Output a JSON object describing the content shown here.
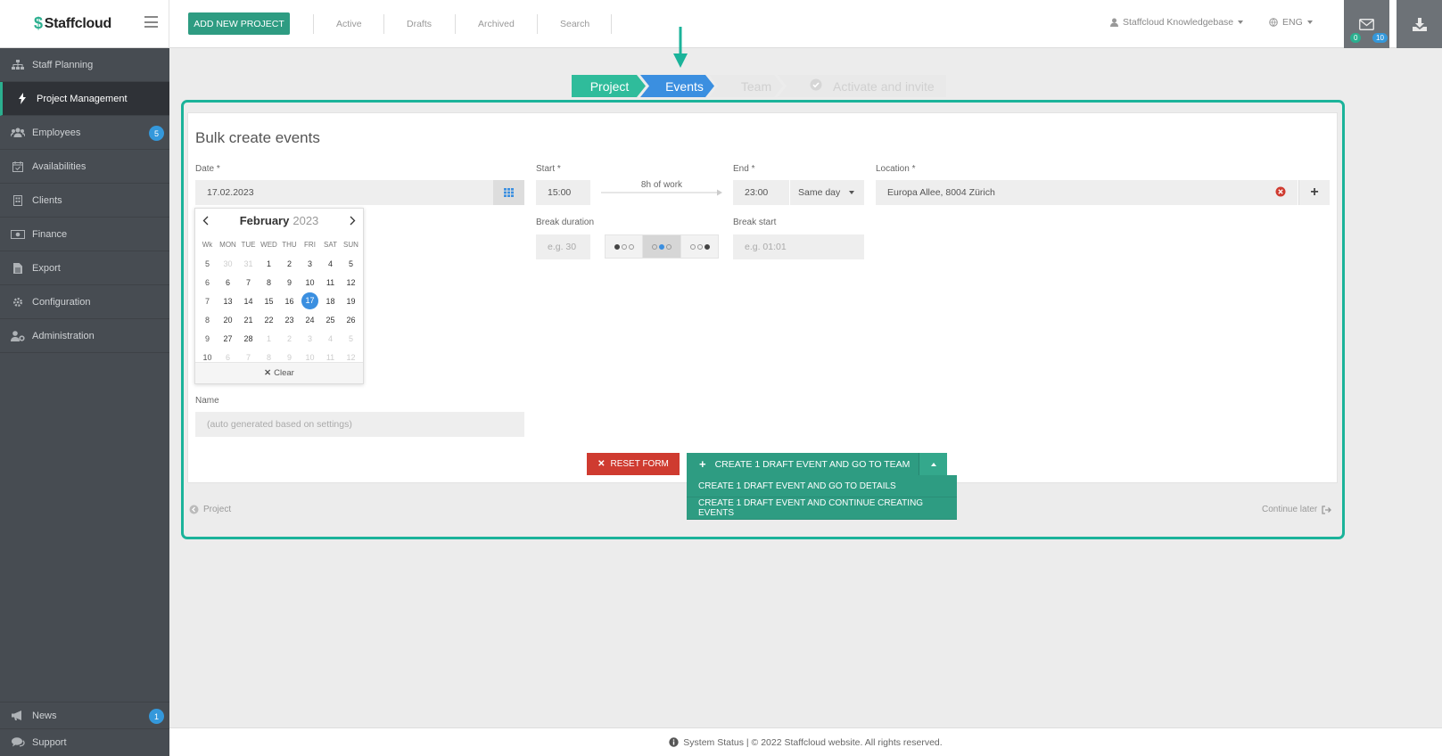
{
  "app": {
    "name": "Staffcloud"
  },
  "topbar": {
    "add_project": "ADD NEW PROJECT",
    "nav": [
      "Active",
      "Drafts",
      "Archived",
      "Search"
    ],
    "account": "Staffcloud Knowledgebase",
    "language": "ENG",
    "messages_count": "0",
    "downloads_count": "10"
  },
  "sidebar": {
    "items": [
      {
        "label": "Staff Planning",
        "icon": "sitemap-icon"
      },
      {
        "label": "Project Management",
        "icon": "bolt-icon"
      },
      {
        "label": "Employees",
        "icon": "users-icon",
        "badge": "5"
      },
      {
        "label": "Availabilities",
        "icon": "calendar-check-icon"
      },
      {
        "label": "Clients",
        "icon": "building-icon"
      },
      {
        "label": "Finance",
        "icon": "money-icon"
      },
      {
        "label": "Export",
        "icon": "file-icon"
      },
      {
        "label": "Configuration",
        "icon": "gear-icon"
      },
      {
        "label": "Administration",
        "icon": "user-gear-icon"
      }
    ],
    "news": {
      "label": "News",
      "badge": "1"
    },
    "support": {
      "label": "Support"
    }
  },
  "wizard": {
    "steps": [
      "Project",
      "Events",
      "Team",
      "Activate and invite"
    ]
  },
  "form": {
    "title": "Bulk create events",
    "date_label": "Date *",
    "date_value": "17.02.2023",
    "start_label": "Start *",
    "start_value": "15:00",
    "work_duration": "8h of work",
    "end_label": "End *",
    "end_value": "23:00",
    "end_day": "Same day",
    "location_label": "Location *",
    "location_value": "Europa Allee, 8004 Zürich",
    "break_duration_label": "Break duration",
    "break_duration_placeholder": "e.g. 30",
    "break_start_label": "Break start",
    "break_start_placeholder": "e.g. 01:01",
    "name_label": "Name",
    "name_placeholder": "(auto generated based on settings)"
  },
  "calendar": {
    "month": "February",
    "year": "2023",
    "headers": [
      "Wk",
      "MON",
      "TUE",
      "WED",
      "THU",
      "FRI",
      "SAT",
      "SUN"
    ],
    "weeks": [
      [
        "5",
        "30",
        "31",
        "1",
        "2",
        "3",
        "4",
        "5"
      ],
      [
        "6",
        "6",
        "7",
        "8",
        "9",
        "10",
        "11",
        "12"
      ],
      [
        "7",
        "13",
        "14",
        "15",
        "16",
        "17",
        "18",
        "19"
      ],
      [
        "8",
        "20",
        "21",
        "22",
        "23",
        "24",
        "25",
        "26"
      ],
      [
        "9",
        "27",
        "28",
        "1",
        "2",
        "3",
        "4",
        "5"
      ],
      [
        "10",
        "6",
        "7",
        "8",
        "9",
        "10",
        "11",
        "12"
      ]
    ],
    "selected": "17",
    "clear": "Clear"
  },
  "actions": {
    "reset": "RESET FORM",
    "create_team": "CREATE 1 DRAFT EVENT AND GO TO TEAM",
    "create_details": "CREATE 1 DRAFT EVENT AND GO TO DETAILS",
    "create_continue": "CREATE 1 DRAFT EVENT AND CONTINUE CREATING EVENTS"
  },
  "bottom_nav": {
    "back": "Project",
    "later": "Continue later"
  },
  "footer": {
    "text": "System Status | © 2022 Staffcloud website. All rights reserved."
  },
  "colors": {
    "accent": "#2e9c82",
    "frame": "#1bb39a",
    "active_step": "#3b8fe0",
    "danger": "#cf3b30"
  }
}
